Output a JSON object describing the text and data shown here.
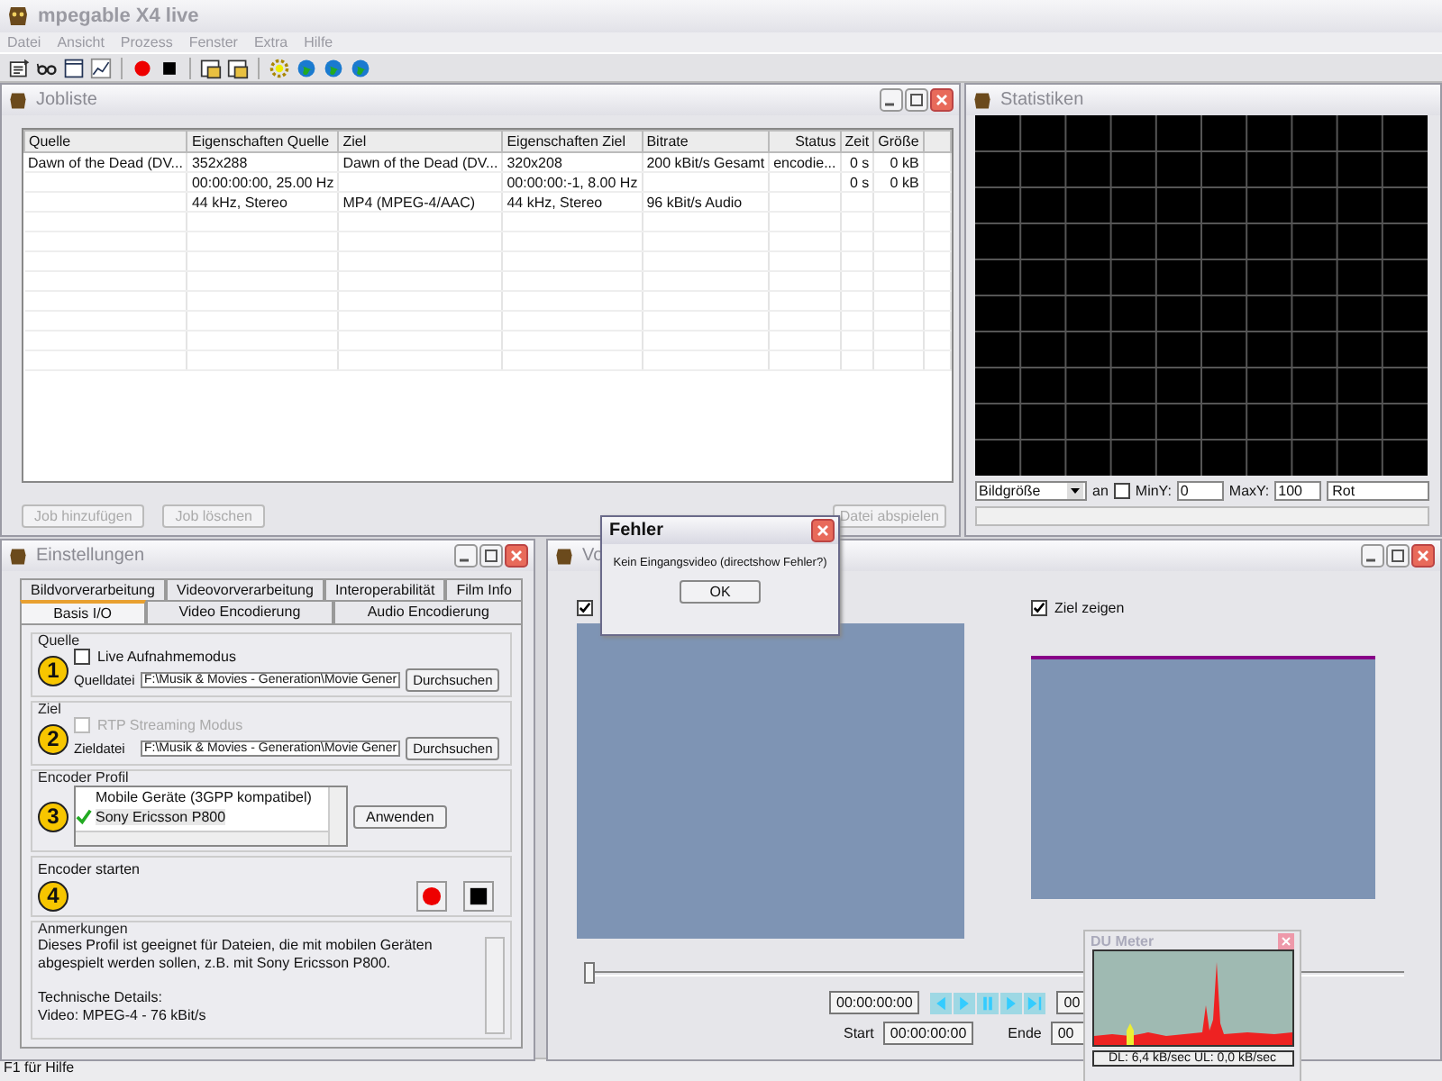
{
  "app": {
    "title": "mpegable X4 live",
    "menu": [
      "Datei",
      "Ansicht",
      "Prozess",
      "Fenster",
      "Extra",
      "Hilfe"
    ]
  },
  "toolbar": [
    {
      "kind": "properties"
    },
    {
      "kind": "glasses"
    },
    {
      "kind": "window"
    },
    {
      "kind": "chart"
    },
    {
      "kind": "record"
    },
    {
      "kind": "stop"
    },
    {
      "kind": "folder"
    },
    {
      "kind": "folder"
    },
    {
      "kind": "gear"
    },
    {
      "kind": "globe"
    },
    {
      "kind": "globe"
    },
    {
      "kind": "globe"
    }
  ],
  "jobliste": {
    "title": "Jobliste",
    "columns": [
      "Quelle",
      "Eigenschaften Quelle",
      "Ziel",
      "Eigenschaften Ziel",
      "Bitrate",
      "Status",
      "Zeit",
      "Größe"
    ],
    "rows": [
      [
        "Dawn of the Dead (DV...",
        "352x288",
        "Dawn of the Dead (DV...",
        "320x208",
        "200 kBit/s Gesamt",
        "encodie...",
        "0 s",
        "0 kB"
      ],
      [
        "",
        "00:00:00:00, 25.00 Hz",
        "",
        "00:00:00:-1, 8.00 Hz",
        "",
        "",
        "0 s",
        "0 kB"
      ],
      [
        "",
        "44 kHz, Stereo",
        "MP4 (MPEG-4/AAC)",
        "44 kHz, Stereo",
        "96 kBit/s Audio",
        "",
        "",
        ""
      ]
    ],
    "buttons": [
      {
        "label": "Job hinzufügen",
        "disabled": true
      },
      {
        "label": "Job löschen",
        "disabled": true
      },
      {
        "label": "Datei abspielen",
        "disabled": true
      }
    ]
  },
  "statistiken": {
    "title": "Statistiken",
    "series": "Bildgröße",
    "on_label": "an",
    "on_checked": false,
    "miny_label": "MinY:",
    "miny": "0",
    "maxy_label": "MaxY:",
    "maxy": "100",
    "line_color": "Rot"
  },
  "einstellungen": {
    "title": "Einstellungen",
    "tab_rows": [
      [
        {
          "label": "Bildvorverarbeitung",
          "selected": false
        },
        {
          "label": "Videovorverarbeitung",
          "selected": false
        },
        {
          "label": "Interoperabilität",
          "selected": false
        },
        {
          "label": "Film Info",
          "selected": false
        }
      ],
      [
        {
          "label": "Basis I/O",
          "selected": true
        },
        {
          "label": "Video Encodierung",
          "selected": false
        },
        {
          "label": "Audio Encodierung",
          "selected": false
        }
      ]
    ],
    "quelle": {
      "legend": "Quelle",
      "step": "1",
      "option": {
        "label": "Live Aufnahmemodus",
        "checked": false,
        "disabled": false
      },
      "file_label": "Quelldatei",
      "file": "F:\\Musik & Movies - Generation\\Movie Gener",
      "browse": "Durchsuchen"
    },
    "ziel": {
      "legend": "Ziel",
      "step": "2",
      "option": {
        "label": "RTP Streaming Modus",
        "checked": false,
        "disabled": true
      },
      "file_label": "Zieldatei",
      "file": "F:\\Musik & Movies - Generation\\Movie Gener",
      "browse": "Durchsuchen"
    },
    "profil": {
      "legend": "Encoder Profil",
      "step": "3",
      "items": [
        {
          "label": "Mobile Geräte (3GPP kompatibel)",
          "selected": false,
          "checked": false
        },
        {
          "label": "Sony Ericsson P800",
          "selected": true,
          "checked": true
        }
      ],
      "apply": "Anwenden"
    },
    "encoder": {
      "legend": "Encoder starten",
      "step": "4"
    },
    "notes": {
      "legend": "Anmerkungen",
      "paragraphs": [
        "Dieses Profil ist geeignet für Dateien, die mit mobilen Geräten abgespielt werden sollen, z.B. mit Sony Ericsson P800.",
        "Technische Details:",
        "Video: MPEG-4 - 76 kBit/s"
      ]
    }
  },
  "vorschau": {
    "title": "Vo",
    "show_source": {
      "checked": true
    },
    "show_target": {
      "label": "Ziel zeigen",
      "checked": true
    },
    "position": {
      "level": 0
    },
    "time_current": "00:00:00:00",
    "time_total": "00",
    "start_label": "Start",
    "start": "00:00:00:00",
    "end_label": "Ende",
    "end": "00"
  },
  "dialog": {
    "title": "Fehler",
    "message": "Kein Eingangsvideo (directshow Fehler?)",
    "button": "OK"
  },
  "du_meter": {
    "title": "DU Meter",
    "readout": "DL: 6,4 kB/sec  UL: 0,0 kB/sec"
  },
  "status_bar": "F1 für Hilfe"
}
